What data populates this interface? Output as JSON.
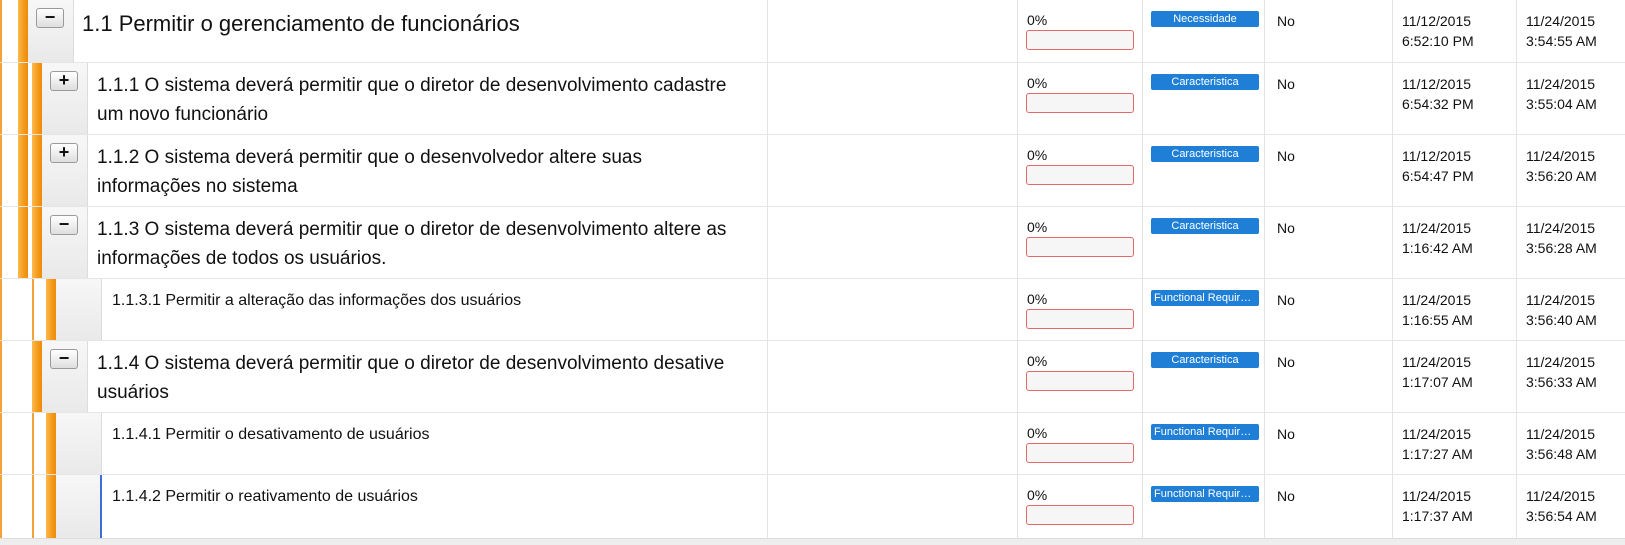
{
  "rows": [
    {
      "title": "1.1 Permitir o gerenciamento de funcionários",
      "toggle": "−",
      "progress": "0%",
      "type": "Necessidade",
      "flag": "No",
      "created": [
        "11/12/2015",
        "6:52:10 PM"
      ],
      "modified": [
        "11/24/2015",
        "3:54:55 AM"
      ]
    },
    {
      "title": "1.1.1 O sistema deverá permitir que o diretor de desenvolvimento cadastre um novo funcionário",
      "toggle": "+",
      "progress": "0%",
      "type": "Caracteristica",
      "flag": "No",
      "created": [
        "11/12/2015",
        "6:54:32 PM"
      ],
      "modified": [
        "11/24/2015",
        "3:55:04 AM"
      ]
    },
    {
      "title": "1.1.2 O sistema deverá permitir que o desenvolvedor altere suas informações no sistema",
      "toggle": "+",
      "progress": "0%",
      "type": "Caracteristica",
      "flag": "No",
      "created": [
        "11/12/2015",
        "6:54:47 PM"
      ],
      "modified": [
        "11/24/2015",
        "3:56:20 AM"
      ]
    },
    {
      "title": "1.1.3 O sistema deverá permitir que o diretor de desenvolvimento altere as informações de todos os usuários.",
      "toggle": "−",
      "progress": "0%",
      "type": "Caracteristica",
      "flag": "No",
      "created": [
        "11/24/2015",
        "1:16:42 AM"
      ],
      "modified": [
        "11/24/2015",
        "3:56:28 AM"
      ]
    },
    {
      "title": "1.1.3.1 Permitir a alteração das informações dos usuários",
      "toggle": "",
      "progress": "0%",
      "type": "Functional Requirement",
      "flag": "No",
      "created": [
        "11/24/2015",
        "1:16:55 AM"
      ],
      "modified": [
        "11/24/2015",
        "3:56:40 AM"
      ]
    },
    {
      "title": "1.1.4 O sistema deverá permitir que o diretor de desenvolvimento desative usuários",
      "toggle": "−",
      "progress": "0%",
      "type": "Caracteristica",
      "flag": "No",
      "created": [
        "11/24/2015",
        "1:17:07 AM"
      ],
      "modified": [
        "11/24/2015",
        "3:56:33 AM"
      ]
    },
    {
      "title": "1.1.4.1 Permitir o desativamento de usuários",
      "toggle": "",
      "progress": "0%",
      "type": "Functional Requirement",
      "flag": "No",
      "created": [
        "11/24/2015",
        "1:17:27 AM"
      ],
      "modified": [
        "11/24/2015",
        "3:56:48 AM"
      ]
    },
    {
      "title": "1.1.4.2 Permitir o reativamento de usuários",
      "toggle": "",
      "progress": "0%",
      "type": "Functional Requirement",
      "flag": "No",
      "created": [
        "11/24/2015",
        "1:17:37 AM"
      ],
      "modified": [
        "11/24/2015",
        "3:56:54 AM"
      ]
    }
  ],
  "colors": {
    "accent_bar": "#f39a1a",
    "badge": "#1f7fd6",
    "progress_border": "#e26a6a"
  }
}
